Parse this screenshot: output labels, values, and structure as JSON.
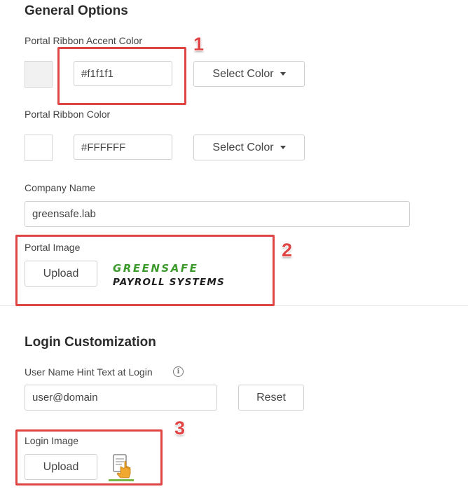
{
  "general": {
    "heading": "General Options",
    "accent": {
      "label": "Portal Ribbon Accent Color",
      "value": "#f1f1f1",
      "swatch_color": "#f1f1f1",
      "button_label": "Select Color"
    },
    "ribbon": {
      "label": "Portal Ribbon Color",
      "value": "#FFFFFF",
      "swatch_color": "#FFFFFF",
      "button_label": "Select Color"
    },
    "company": {
      "label": "Company Name",
      "value": "greensafe.lab"
    },
    "portal_image": {
      "label": "Portal Image",
      "upload_label": "Upload",
      "logo_line1": "GREENSAFE",
      "logo_line2": "PAYROLL SYSTEMS"
    }
  },
  "login": {
    "heading": "Login Customization",
    "hint": {
      "label": "User Name Hint Text at Login",
      "value": "user@domain",
      "reset_label": "Reset"
    },
    "login_image": {
      "label": "Login Image",
      "upload_label": "Upload"
    }
  },
  "annotations": [
    "1",
    "2",
    "3"
  ],
  "colors": {
    "annotation": "#e04545",
    "logo_green": "#3a9a2a"
  }
}
